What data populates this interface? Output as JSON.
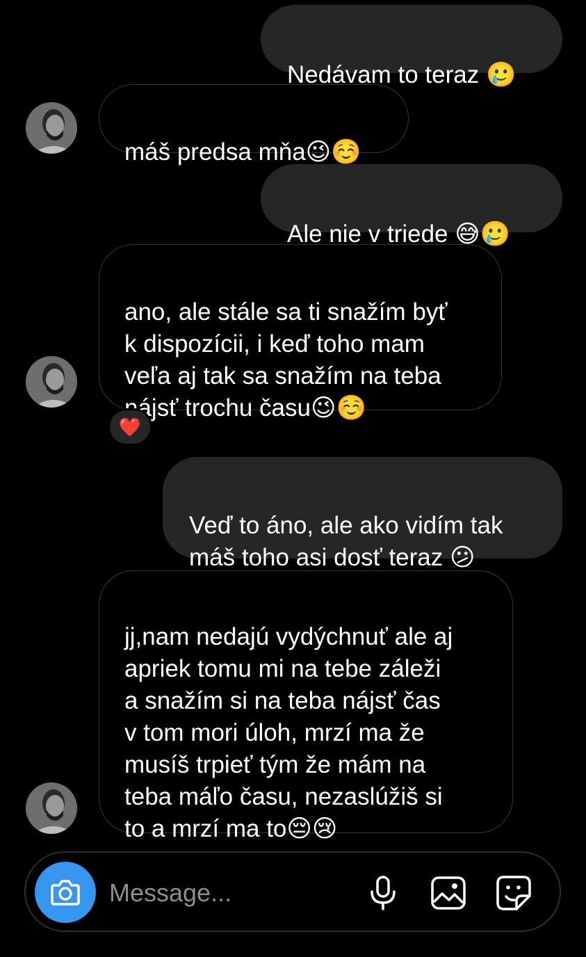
{
  "messages": [
    {
      "side": "sent",
      "text": "Nedávam to teraz 🥲"
    },
    {
      "side": "received",
      "text": "máš predsa mňa😉☺️"
    },
    {
      "side": "sent",
      "text": "Ale nie v triede 😅🥲"
    },
    {
      "side": "received",
      "text": "ano, ale stále sa ti snažím byť\nk dispozícii, i keď toho mam\nveľa aj tak sa snažím na teba\nnájsť trochu času😉☺️",
      "reaction": "❤️"
    },
    {
      "side": "sent",
      "text": "Veď to áno, ale ako vidím tak\nmáš toho asi dosť teraz 😕"
    },
    {
      "side": "received",
      "text": "jj,nam nedajú vydýchnuť ale aj\napriek tomu mi na tebe záleži\na snažím si na teba nájsť čas\nv tom mori úloh, mrzí ma že\nmusíš trpieť tým že mám na\nteba máľo času, nezaslúžiš si\nto a mrzí ma to😔😢"
    }
  ],
  "composer": {
    "placeholder": "Message..."
  },
  "icons": {
    "camera": "camera-icon",
    "mic": "microphone-icon",
    "gallery": "gallery-icon",
    "sticker": "sticker-icon"
  },
  "colors": {
    "background": "#000000",
    "sent_bubble": "#262626",
    "received_border": "#363636",
    "camera_button": "#3797f0",
    "placeholder": "#8e8e8e"
  }
}
